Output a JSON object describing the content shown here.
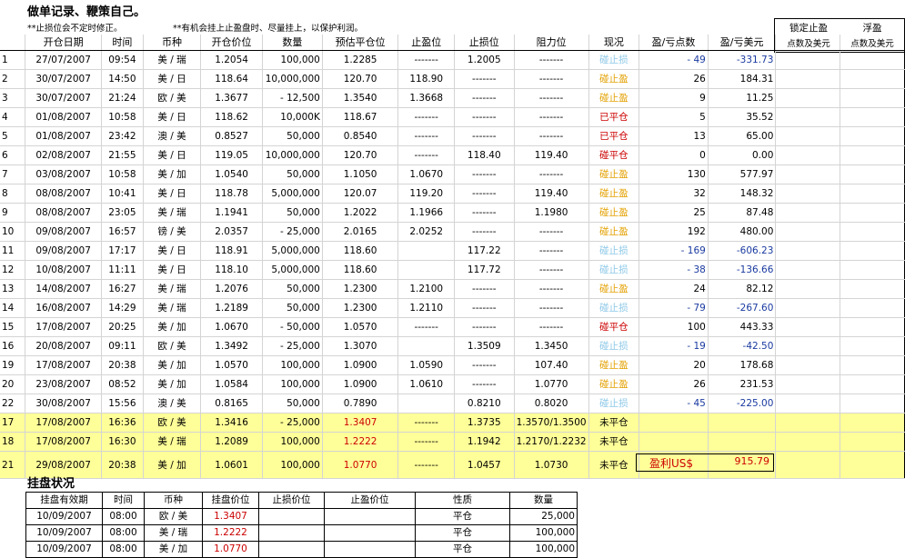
{
  "title": "做单记录、鞭策自己。",
  "note1": "**止损位会不定时修正。",
  "note2": "**有机会挂上止盈盘时、尽量挂上，以保护利润。",
  "side_header": {
    "col1": "锁定止盈",
    "col2": "浮盈",
    "sub1": "点数及美元",
    "sub2": "点数及美元"
  },
  "headers": [
    "",
    "开仓日期",
    "时间",
    "币种",
    "开仓价位",
    "数量",
    "预估平仓位",
    "止盈位",
    "止损位",
    "阻力位",
    "现况",
    "盈/亏点数",
    "盈/亏美元"
  ],
  "rows": [
    {
      "n": "1",
      "date": "27/07/2007",
      "time": "09:54",
      "pair": "美 / 瑞",
      "open": "1.2054",
      "qty": "100,000",
      "est": "1.2285",
      "tp": "-------",
      "sl": "1.2005",
      "res": "-------",
      "status": "碰止损",
      "sc": "lb",
      "pts": "- 49",
      "usd": "-331.73",
      "neg": true
    },
    {
      "n": "2",
      "date": "30/07/2007",
      "time": "14:50",
      "pair": "美 / 日",
      "open": "118.64",
      "qty": "10,000,000",
      "est": "120.70",
      "tp": "118.90",
      "sl": "-------",
      "res": "-------",
      "status": "碰止盈",
      "sc": "or",
      "pts": "26",
      "usd": "184.31",
      "neg": false
    },
    {
      "n": "3",
      "date": "30/07/2007",
      "time": "21:24",
      "pair": "欧 / 美",
      "open": "1.3677",
      "qty": "- 12,500",
      "est": "1.3540",
      "tp": "1.3668",
      "sl": "-------",
      "res": "-------",
      "status": "碰止盈",
      "sc": "or",
      "pts": "9",
      "usd": "11.25",
      "neg": false
    },
    {
      "n": "4",
      "date": "01/08/2007",
      "time": "10:58",
      "pair": "美 / 日",
      "open": "118.62",
      "qty": "10,000K",
      "est": "118.67",
      "tp": "-------",
      "sl": "-------",
      "res": "-------",
      "status": "已平仓",
      "sc": "red",
      "pts": "5",
      "usd": "35.52",
      "neg": false
    },
    {
      "n": "5",
      "date": "01/08/2007",
      "time": "23:42",
      "pair": "澳 / 美",
      "open": "0.8527",
      "qty": "50,000",
      "est": "0.8540",
      "tp": "-------",
      "sl": "-------",
      "res": "-------",
      "status": "已平仓",
      "sc": "red",
      "pts": "13",
      "usd": "65.00",
      "neg": false
    },
    {
      "n": "6",
      "date": "02/08/2007",
      "time": "21:55",
      "pair": "美 / 日",
      "open": "119.05",
      "qty": "10,000,000",
      "est": "120.70",
      "tp": "-------",
      "sl": "118.40",
      "res": "119.40",
      "status": "碰平仓",
      "sc": "red",
      "pts": "0",
      "usd": "0.00",
      "neg": false
    },
    {
      "n": "7",
      "date": "03/08/2007",
      "time": "10:58",
      "pair": "美 / 加",
      "open": "1.0540",
      "qty": "50,000",
      "est": "1.1050",
      "tp": "1.0670",
      "sl": "-------",
      "res": "-------",
      "status": "碰止盈",
      "sc": "or",
      "pts": "130",
      "usd": "577.97",
      "neg": false
    },
    {
      "n": "8",
      "date": "08/08/2007",
      "time": "10:41",
      "pair": "美 / 日",
      "open": "118.78",
      "qty": "5,000,000",
      "est": "120.07",
      "tp": "119.20",
      "sl": "-------",
      "res": "119.40",
      "status": "碰止盈",
      "sc": "or",
      "pts": "32",
      "usd": "148.32",
      "neg": false
    },
    {
      "n": "9",
      "date": "08/08/2007",
      "time": "23:05",
      "pair": "美 / 瑞",
      "open": "1.1941",
      "qty": "50,000",
      "est": "1.2022",
      "tp": "1.1966",
      "sl": "-------",
      "res": "1.1980",
      "status": "碰止盈",
      "sc": "or",
      "pts": "25",
      "usd": "87.48",
      "neg": false
    },
    {
      "n": "10",
      "date": "09/08/2007",
      "time": "16:57",
      "pair": "镑 / 美",
      "open": "2.0357",
      "qty": "- 25,000",
      "est": "2.0165",
      "tp": "2.0252",
      "sl": "-------",
      "res": "-------",
      "status": "碰止盈",
      "sc": "or",
      "pts": "192",
      "usd": "480.00",
      "neg": false
    },
    {
      "n": "11",
      "date": "09/08/2007",
      "time": "17:17",
      "pair": "美 / 日",
      "open": "118.91",
      "qty": "5,000,000",
      "est": "118.60",
      "tp": "",
      "sl": "117.22",
      "res": "-------",
      "status": "碰止损",
      "sc": "lb",
      "pts": "- 169",
      "usd": "-606.23",
      "neg": true
    },
    {
      "n": "12",
      "date": "10/08/2007",
      "time": "11:11",
      "pair": "美 / 日",
      "open": "118.10",
      "qty": "5,000,000",
      "est": "118.60",
      "tp": "",
      "sl": "117.72",
      "res": "-------",
      "status": "碰止损",
      "sc": "lb",
      "pts": "- 38",
      "usd": "-136.66",
      "neg": true
    },
    {
      "n": "13",
      "date": "14/08/2007",
      "time": "16:27",
      "pair": "美 / 瑞",
      "open": "1.2076",
      "qty": "50,000",
      "est": "1.2300",
      "tp": "1.2100",
      "sl": "-------",
      "res": "-------",
      "status": "碰止盈",
      "sc": "or",
      "pts": "24",
      "usd": "82.12",
      "neg": false
    },
    {
      "n": "14",
      "date": "16/08/2007",
      "time": "14:29",
      "pair": "美 / 瑞",
      "open": "1.2189",
      "qty": "50,000",
      "est": "1.2300",
      "tp": "1.2110",
      "sl": "-------",
      "res": "-------",
      "status": "碰止损",
      "sc": "lb",
      "pts": "- 79",
      "usd": "-267.60",
      "neg": true
    },
    {
      "n": "15",
      "date": "17/08/2007",
      "time": "20:25",
      "pair": "美 / 加",
      "open": "1.0670",
      "qty": "- 50,000",
      "est": "1.0570",
      "tp": "-------",
      "sl": "-------",
      "res": "-------",
      "status": "碰平仓",
      "sc": "red",
      "pts": "100",
      "usd": "443.33",
      "neg": false
    },
    {
      "n": "16",
      "date": "20/08/2007",
      "time": "09:11",
      "pair": "欧 / 美",
      "open": "1.3492",
      "qty": "- 25,000",
      "est": "1.3070",
      "tp": "",
      "sl": "1.3509",
      "res": "1.3450",
      "status": "碰止损",
      "sc": "lb",
      "pts": "- 19",
      "usd": "-42.50",
      "neg": true
    },
    {
      "n": "19",
      "date": "17/08/2007",
      "time": "20:38",
      "pair": "美 / 加",
      "open": "1.0570",
      "qty": "100,000",
      "est": "1.0900",
      "tp": "1.0590",
      "sl": "-------",
      "res": "107.40",
      "status": "碰止盈",
      "sc": "or",
      "pts": "20",
      "usd": "178.68",
      "neg": false
    },
    {
      "n": "20",
      "date": "23/08/2007",
      "time": "08:52",
      "pair": "美 / 加",
      "open": "1.0584",
      "qty": "100,000",
      "est": "1.0900",
      "tp": "1.0610",
      "sl": "-------",
      "res": "1.0770",
      "status": "碰止盈",
      "sc": "or",
      "pts": "26",
      "usd": "231.53",
      "neg": false
    },
    {
      "n": "22",
      "date": "30/08/2007",
      "time": "15:56",
      "pair": "澳 / 美",
      "open": "0.8165",
      "qty": "50,000",
      "est": "0.7890",
      "tp": "",
      "sl": "0.8210",
      "res": "0.8020",
      "status": "碰止损",
      "sc": "lb",
      "pts": "- 45",
      "usd": "-225.00",
      "neg": true
    }
  ],
  "open_rows": [
    {
      "n": "17",
      "date": "17/08/2007",
      "time": "16:36",
      "pair": "欧 / 美",
      "open": "1.3416",
      "qty": "- 25,000",
      "est": "1.3407",
      "tp": "-------",
      "sl": "1.3735",
      "res": "1.3570/1.3500",
      "status": "未平仓"
    },
    {
      "n": "18",
      "date": "17/08/2007",
      "time": "16:30",
      "pair": "美 / 瑞",
      "open": "1.2089",
      "qty": "100,000",
      "est": "1.2222",
      "tp": "-------",
      "sl": "1.1942",
      "res": "1.2170/1.2232",
      "status": "未平仓"
    },
    {
      "n": "21",
      "date": "29/08/2007",
      "time": "20:38",
      "pair": "美 / 加",
      "open": "1.0601",
      "qty": "100,000",
      "est": "1.0770",
      "tp": "-------",
      "sl": "1.0457",
      "res": "1.0730",
      "status": "未平仓"
    }
  ],
  "total": {
    "label": "盈利US$",
    "value": "915.79"
  },
  "pending": {
    "title": "挂盘状况",
    "headers": [
      "挂盘有效期",
      "时间",
      "币种",
      "挂盘价位",
      "止损价位",
      "止盈价位",
      "性质",
      "数量"
    ],
    "rows": [
      {
        "date": "10/09/2007",
        "time": "08:00",
        "pair": "欧 / 美",
        "price": "1.3407",
        "sl": "",
        "tp": "",
        "type": "平仓",
        "qty": "25,000"
      },
      {
        "date": "10/09/2007",
        "time": "08:00",
        "pair": "美 / 瑞",
        "price": "1.2222",
        "sl": "",
        "tp": "",
        "type": "平仓",
        "qty": "100,000"
      },
      {
        "date": "10/09/2007",
        "time": "08:00",
        "pair": "美 / 加",
        "price": "1.0770",
        "sl": "",
        "tp": "",
        "type": "平仓",
        "qty": "100,000"
      }
    ]
  }
}
